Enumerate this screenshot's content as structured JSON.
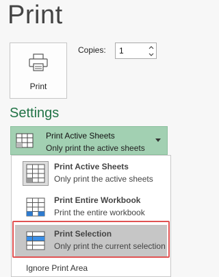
{
  "page": {
    "title": "Print"
  },
  "print_button": {
    "label": "Print",
    "icon": "printer-icon"
  },
  "copies": {
    "label": "Copies:",
    "value": "1"
  },
  "settings": {
    "title": "Settings",
    "accent": "#217346",
    "selected": {
      "title": "Print Active Sheets",
      "subtitle": "Only print the active sheets",
      "icon": "active-sheets-icon"
    }
  },
  "dropdown": {
    "options": [
      {
        "title": "Print Active Sheets",
        "subtitle": "Only print the active sheets",
        "icon": "active-sheets-icon"
      },
      {
        "title": "Print Entire Workbook",
        "subtitle": "Print the entire workbook",
        "icon": "workbook-icon"
      },
      {
        "title": "Print Selection",
        "subtitle": "Only print the current selection",
        "icon": "selection-icon",
        "highlighted": true
      }
    ],
    "ignore_print_area": "Ignore Print Area"
  }
}
